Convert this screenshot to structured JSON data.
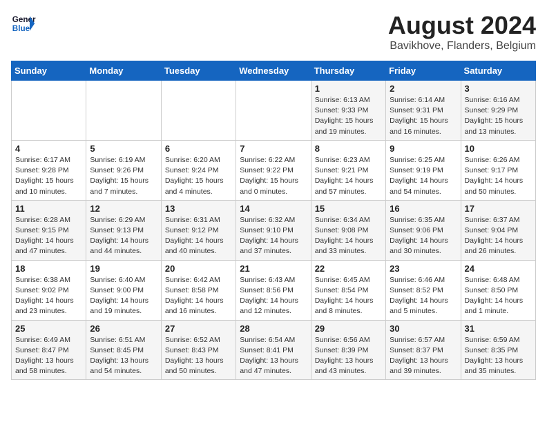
{
  "header": {
    "logo_line1": "General",
    "logo_line2": "Blue",
    "month": "August 2024",
    "location": "Bavikhove, Flanders, Belgium"
  },
  "days_of_week": [
    "Sunday",
    "Monday",
    "Tuesday",
    "Wednesday",
    "Thursday",
    "Friday",
    "Saturday"
  ],
  "weeks": [
    [
      {
        "day": "",
        "info": ""
      },
      {
        "day": "",
        "info": ""
      },
      {
        "day": "",
        "info": ""
      },
      {
        "day": "",
        "info": ""
      },
      {
        "day": "1",
        "info": "Sunrise: 6:13 AM\nSunset: 9:33 PM\nDaylight: 15 hours\nand 19 minutes."
      },
      {
        "day": "2",
        "info": "Sunrise: 6:14 AM\nSunset: 9:31 PM\nDaylight: 15 hours\nand 16 minutes."
      },
      {
        "day": "3",
        "info": "Sunrise: 6:16 AM\nSunset: 9:29 PM\nDaylight: 15 hours\nand 13 minutes."
      }
    ],
    [
      {
        "day": "4",
        "info": "Sunrise: 6:17 AM\nSunset: 9:28 PM\nDaylight: 15 hours\nand 10 minutes."
      },
      {
        "day": "5",
        "info": "Sunrise: 6:19 AM\nSunset: 9:26 PM\nDaylight: 15 hours\nand 7 minutes."
      },
      {
        "day": "6",
        "info": "Sunrise: 6:20 AM\nSunset: 9:24 PM\nDaylight: 15 hours\nand 4 minutes."
      },
      {
        "day": "7",
        "info": "Sunrise: 6:22 AM\nSunset: 9:22 PM\nDaylight: 15 hours\nand 0 minutes."
      },
      {
        "day": "8",
        "info": "Sunrise: 6:23 AM\nSunset: 9:21 PM\nDaylight: 14 hours\nand 57 minutes."
      },
      {
        "day": "9",
        "info": "Sunrise: 6:25 AM\nSunset: 9:19 PM\nDaylight: 14 hours\nand 54 minutes."
      },
      {
        "day": "10",
        "info": "Sunrise: 6:26 AM\nSunset: 9:17 PM\nDaylight: 14 hours\nand 50 minutes."
      }
    ],
    [
      {
        "day": "11",
        "info": "Sunrise: 6:28 AM\nSunset: 9:15 PM\nDaylight: 14 hours\nand 47 minutes."
      },
      {
        "day": "12",
        "info": "Sunrise: 6:29 AM\nSunset: 9:13 PM\nDaylight: 14 hours\nand 44 minutes."
      },
      {
        "day": "13",
        "info": "Sunrise: 6:31 AM\nSunset: 9:12 PM\nDaylight: 14 hours\nand 40 minutes."
      },
      {
        "day": "14",
        "info": "Sunrise: 6:32 AM\nSunset: 9:10 PM\nDaylight: 14 hours\nand 37 minutes."
      },
      {
        "day": "15",
        "info": "Sunrise: 6:34 AM\nSunset: 9:08 PM\nDaylight: 14 hours\nand 33 minutes."
      },
      {
        "day": "16",
        "info": "Sunrise: 6:35 AM\nSunset: 9:06 PM\nDaylight: 14 hours\nand 30 minutes."
      },
      {
        "day": "17",
        "info": "Sunrise: 6:37 AM\nSunset: 9:04 PM\nDaylight: 14 hours\nand 26 minutes."
      }
    ],
    [
      {
        "day": "18",
        "info": "Sunrise: 6:38 AM\nSunset: 9:02 PM\nDaylight: 14 hours\nand 23 minutes."
      },
      {
        "day": "19",
        "info": "Sunrise: 6:40 AM\nSunset: 9:00 PM\nDaylight: 14 hours\nand 19 minutes."
      },
      {
        "day": "20",
        "info": "Sunrise: 6:42 AM\nSunset: 8:58 PM\nDaylight: 14 hours\nand 16 minutes."
      },
      {
        "day": "21",
        "info": "Sunrise: 6:43 AM\nSunset: 8:56 PM\nDaylight: 14 hours\nand 12 minutes."
      },
      {
        "day": "22",
        "info": "Sunrise: 6:45 AM\nSunset: 8:54 PM\nDaylight: 14 hours\nand 8 minutes."
      },
      {
        "day": "23",
        "info": "Sunrise: 6:46 AM\nSunset: 8:52 PM\nDaylight: 14 hours\nand 5 minutes."
      },
      {
        "day": "24",
        "info": "Sunrise: 6:48 AM\nSunset: 8:50 PM\nDaylight: 14 hours\nand 1 minute."
      }
    ],
    [
      {
        "day": "25",
        "info": "Sunrise: 6:49 AM\nSunset: 8:47 PM\nDaylight: 13 hours\nand 58 minutes."
      },
      {
        "day": "26",
        "info": "Sunrise: 6:51 AM\nSunset: 8:45 PM\nDaylight: 13 hours\nand 54 minutes."
      },
      {
        "day": "27",
        "info": "Sunrise: 6:52 AM\nSunset: 8:43 PM\nDaylight: 13 hours\nand 50 minutes."
      },
      {
        "day": "28",
        "info": "Sunrise: 6:54 AM\nSunset: 8:41 PM\nDaylight: 13 hours\nand 47 minutes."
      },
      {
        "day": "29",
        "info": "Sunrise: 6:56 AM\nSunset: 8:39 PM\nDaylight: 13 hours\nand 43 minutes."
      },
      {
        "day": "30",
        "info": "Sunrise: 6:57 AM\nSunset: 8:37 PM\nDaylight: 13 hours\nand 39 minutes."
      },
      {
        "day": "31",
        "info": "Sunrise: 6:59 AM\nSunset: 8:35 PM\nDaylight: 13 hours\nand 35 minutes."
      }
    ]
  ]
}
